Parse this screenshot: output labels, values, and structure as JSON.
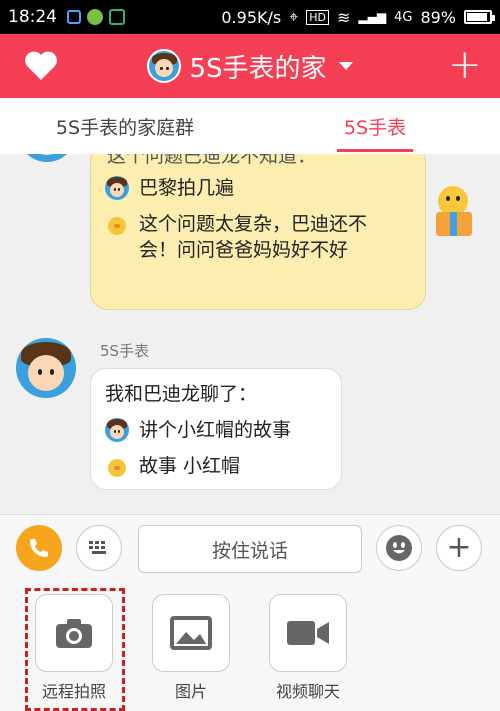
{
  "statusbar": {
    "time": "18:24",
    "speed": "0.95K/s",
    "network": "4G",
    "battery": "89%",
    "battery_level": 0.89
  },
  "header": {
    "title": "5S手表的家"
  },
  "tabs": [
    {
      "label": "5S手表的家庭群",
      "active": false
    },
    {
      "label": "5S手表",
      "active": true
    }
  ],
  "chat": {
    "partial_top_text": "这个问题巴迪龙不知道：",
    "yellow_lines": [
      {
        "speaker": "boy",
        "text": "巴黎拍几遍"
      },
      {
        "speaker": "chick",
        "text": "这个问题太复杂，巴迪还不会！问问爸爸妈妈好不好"
      }
    ],
    "sender_name": "5S手表",
    "white_intro": "我和巴迪龙聊了：",
    "white_lines": [
      {
        "speaker": "boy",
        "text": "讲个小红帽的故事"
      },
      {
        "speaker": "chick",
        "text": "故事 小红帽"
      }
    ]
  },
  "inputbar": {
    "talk_label": "按住说话"
  },
  "tools": [
    {
      "label": "远程拍照",
      "icon": "camera-icon"
    },
    {
      "label": "图片",
      "icon": "image-icon"
    },
    {
      "label": "视频聊天",
      "icon": "video-icon"
    }
  ],
  "colors": {
    "accent": "#f43f55",
    "bubble": "#fcedb0",
    "call": "#f7a51d",
    "highlight": "#cc1f1f"
  }
}
